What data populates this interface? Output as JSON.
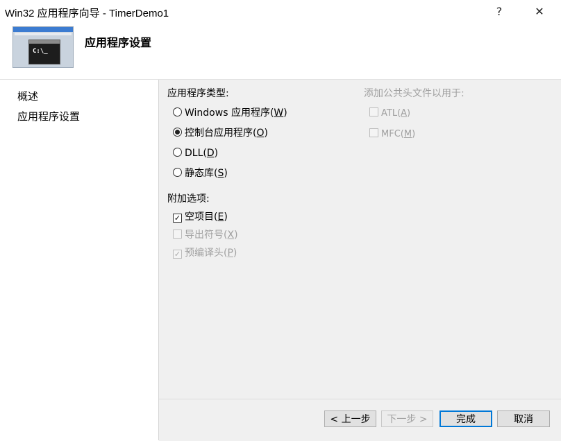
{
  "window": {
    "title": "Win32 应用程序向导 - TimerDemo1",
    "help": "?",
    "close": "✕"
  },
  "header": {
    "title": "应用程序设置",
    "thumb_prompt": "C:\\_"
  },
  "sidebar": {
    "items": [
      {
        "label": "概述"
      },
      {
        "label": "应用程序设置"
      }
    ]
  },
  "app_type": {
    "label": "应用程序类型:",
    "selected": "控制台应用程序",
    "options": [
      {
        "text": "Windows 应用程序(",
        "key": "W",
        "end": ")"
      },
      {
        "text": "控制台应用程序(",
        "key": "O",
        "end": ")"
      },
      {
        "text": "DLL(",
        "key": "D",
        "end": ")"
      },
      {
        "text": "静态库(",
        "key": "S",
        "end": ")"
      }
    ]
  },
  "extra": {
    "label": "附加选项:",
    "options": [
      {
        "text": "空项目(",
        "key": "E",
        "end": ")",
        "checked": true,
        "enabled": true
      },
      {
        "text": "导出符号(",
        "key": "X",
        "end": ")",
        "checked": false,
        "enabled": false
      },
      {
        "text": "预编译头(",
        "key": "P",
        "end": ")",
        "checked": true,
        "enabled": false
      }
    ]
  },
  "common_headers": {
    "label": "添加公共头文件以用于:",
    "options": [
      {
        "text": "ATL(",
        "key": "A",
        "end": ")",
        "checked": false,
        "enabled": false
      },
      {
        "text": "MFC(",
        "key": "M",
        "end": ")",
        "checked": false,
        "enabled": false
      }
    ]
  },
  "buttons": {
    "prev": "< 上一步",
    "next": "下一步 >",
    "finish": "完成",
    "cancel": "取消"
  },
  "colors": {
    "accent": "#0078d7",
    "panel": "#f0f0f0",
    "disabled_text": "#a0a0a0"
  }
}
